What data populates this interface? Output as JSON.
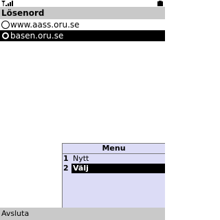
{
  "status_bar": {
    "signal_icon": "signal-strength-icon",
    "battery_icon": "battery-icon"
  },
  "title_bar": {
    "title": "Lösenord"
  },
  "list": {
    "items": [
      {
        "label": "www.aass.oru.se",
        "checked": false
      },
      {
        "label": "basen.oru.se",
        "checked": true
      }
    ]
  },
  "menu": {
    "title": "Menu",
    "items": [
      {
        "number": "1",
        "label": "Nytt"
      },
      {
        "number": "2",
        "label": "Välj"
      }
    ]
  },
  "softkeys": {
    "left": "Avsluta"
  },
  "colors": {
    "bar_gray": "#c9c9c9",
    "menu_bg": "#dcdcf6",
    "selection": "#000000"
  }
}
